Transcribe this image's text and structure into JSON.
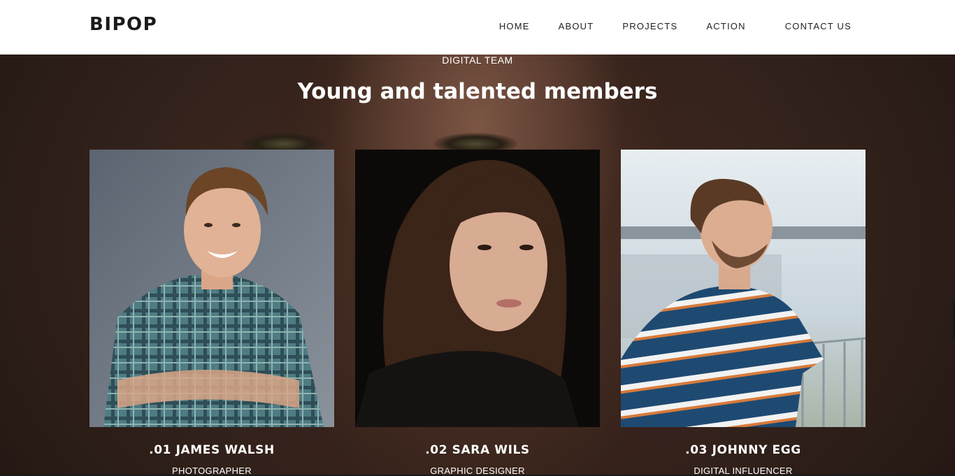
{
  "header": {
    "logo": "BIPOP",
    "nav": [
      "HOME",
      "ABOUT",
      "PROJECTS",
      "ACTION",
      "CONTACT US"
    ]
  },
  "section": {
    "subtitle": "DIGITAL TEAM",
    "title": "Young and talented members"
  },
  "members": [
    {
      "name": ".01 JAMES WALSH",
      "role": "PHOTOGRAPHER"
    },
    {
      "name": ".02 SARA WILS",
      "role": "GRAPHIC DESIGNER"
    },
    {
      "name": ".03 JOHNNY EGG",
      "role": "DIGITAL INFLUENCER"
    }
  ]
}
